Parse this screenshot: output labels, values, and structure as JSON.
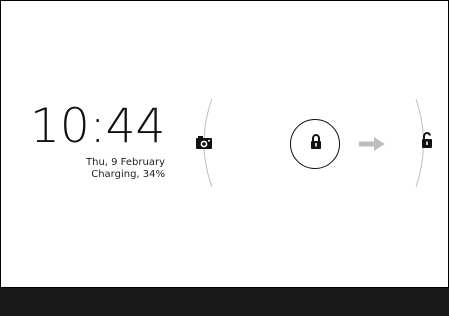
{
  "lockscreen": {
    "time": "10:44",
    "date": "Thu, 9 February",
    "charging_status": "Charging, 34%"
  },
  "icons": {
    "camera": "camera-icon",
    "lock": "lock-icon",
    "arrow": "arrow-right-icon",
    "unlock": "unlock-icon"
  },
  "colors": {
    "background": "#ffffff",
    "navbar": "#191919",
    "arrow": "#bdbdbd",
    "text": "#111111"
  }
}
